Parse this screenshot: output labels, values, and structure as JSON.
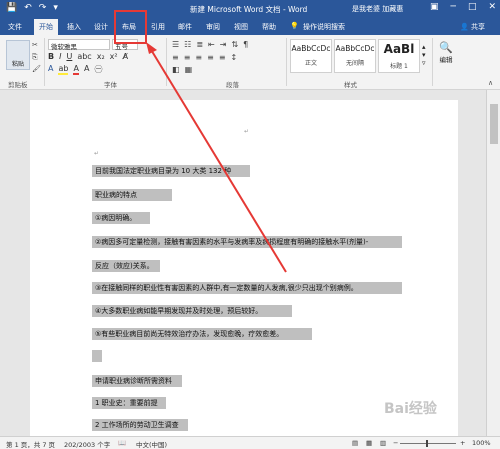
{
  "window": {
    "title": "新建 Microsoft Word 文档 - Word",
    "user": "是我老婆 加藏惠",
    "help_tab": "操作说明搜索",
    "share": "共享"
  },
  "tabs": [
    {
      "label": "文件"
    },
    {
      "label": "开始"
    },
    {
      "label": "插入"
    },
    {
      "label": "设计"
    },
    {
      "label": "布局"
    },
    {
      "label": "引用"
    },
    {
      "label": "邮件"
    },
    {
      "label": "审阅"
    },
    {
      "label": "视图"
    },
    {
      "label": "帮助"
    }
  ],
  "ribbon": {
    "paste_label": "粘贴",
    "clipboard_group": "剪贴板",
    "font_name": "微软雅黑",
    "font_size": "五号",
    "font_group": "字体",
    "paragraph_group": "段落",
    "styles_group": "样式",
    "styles": [
      {
        "preview": "AaBbCcDc",
        "name": "正文"
      },
      {
        "preview": "AaBbCcDc",
        "name": "无间隔"
      },
      {
        "preview": "AaBl",
        "name": "标题 1"
      }
    ],
    "edit_label": "编辑"
  },
  "document": {
    "lines": [
      "目前我国法定职业病目录为  10 大类 132 种",
      "职业病的特点",
      "①病因明确。",
      "②病因多可定量检测，接触有害因素的水平与发病率及病损程度有明确的接触水平(剂量)-",
      "反应（效应)关系。",
      "③在接触同样的职业性有害因素的人群中,有一定数量的人发病,很少只出现个别病例。",
      "④大多数职业病如能早期发现并及时处理，预后较好。",
      "⑤有些职业病目前尚无特效治疗办法，发现愈晚，疗效愈差。",
      "",
      "申请职业病诊断所需资料",
      "1 职业史：重要前提",
      "2 工作场所的劳动卫生调查"
    ]
  },
  "status": {
    "page": "第 1 页，共 7 页",
    "words": "202/2003 个字",
    "language": "中文(中国)",
    "zoom": "100%"
  },
  "annotation": {
    "highlight_color": "#e53935"
  }
}
